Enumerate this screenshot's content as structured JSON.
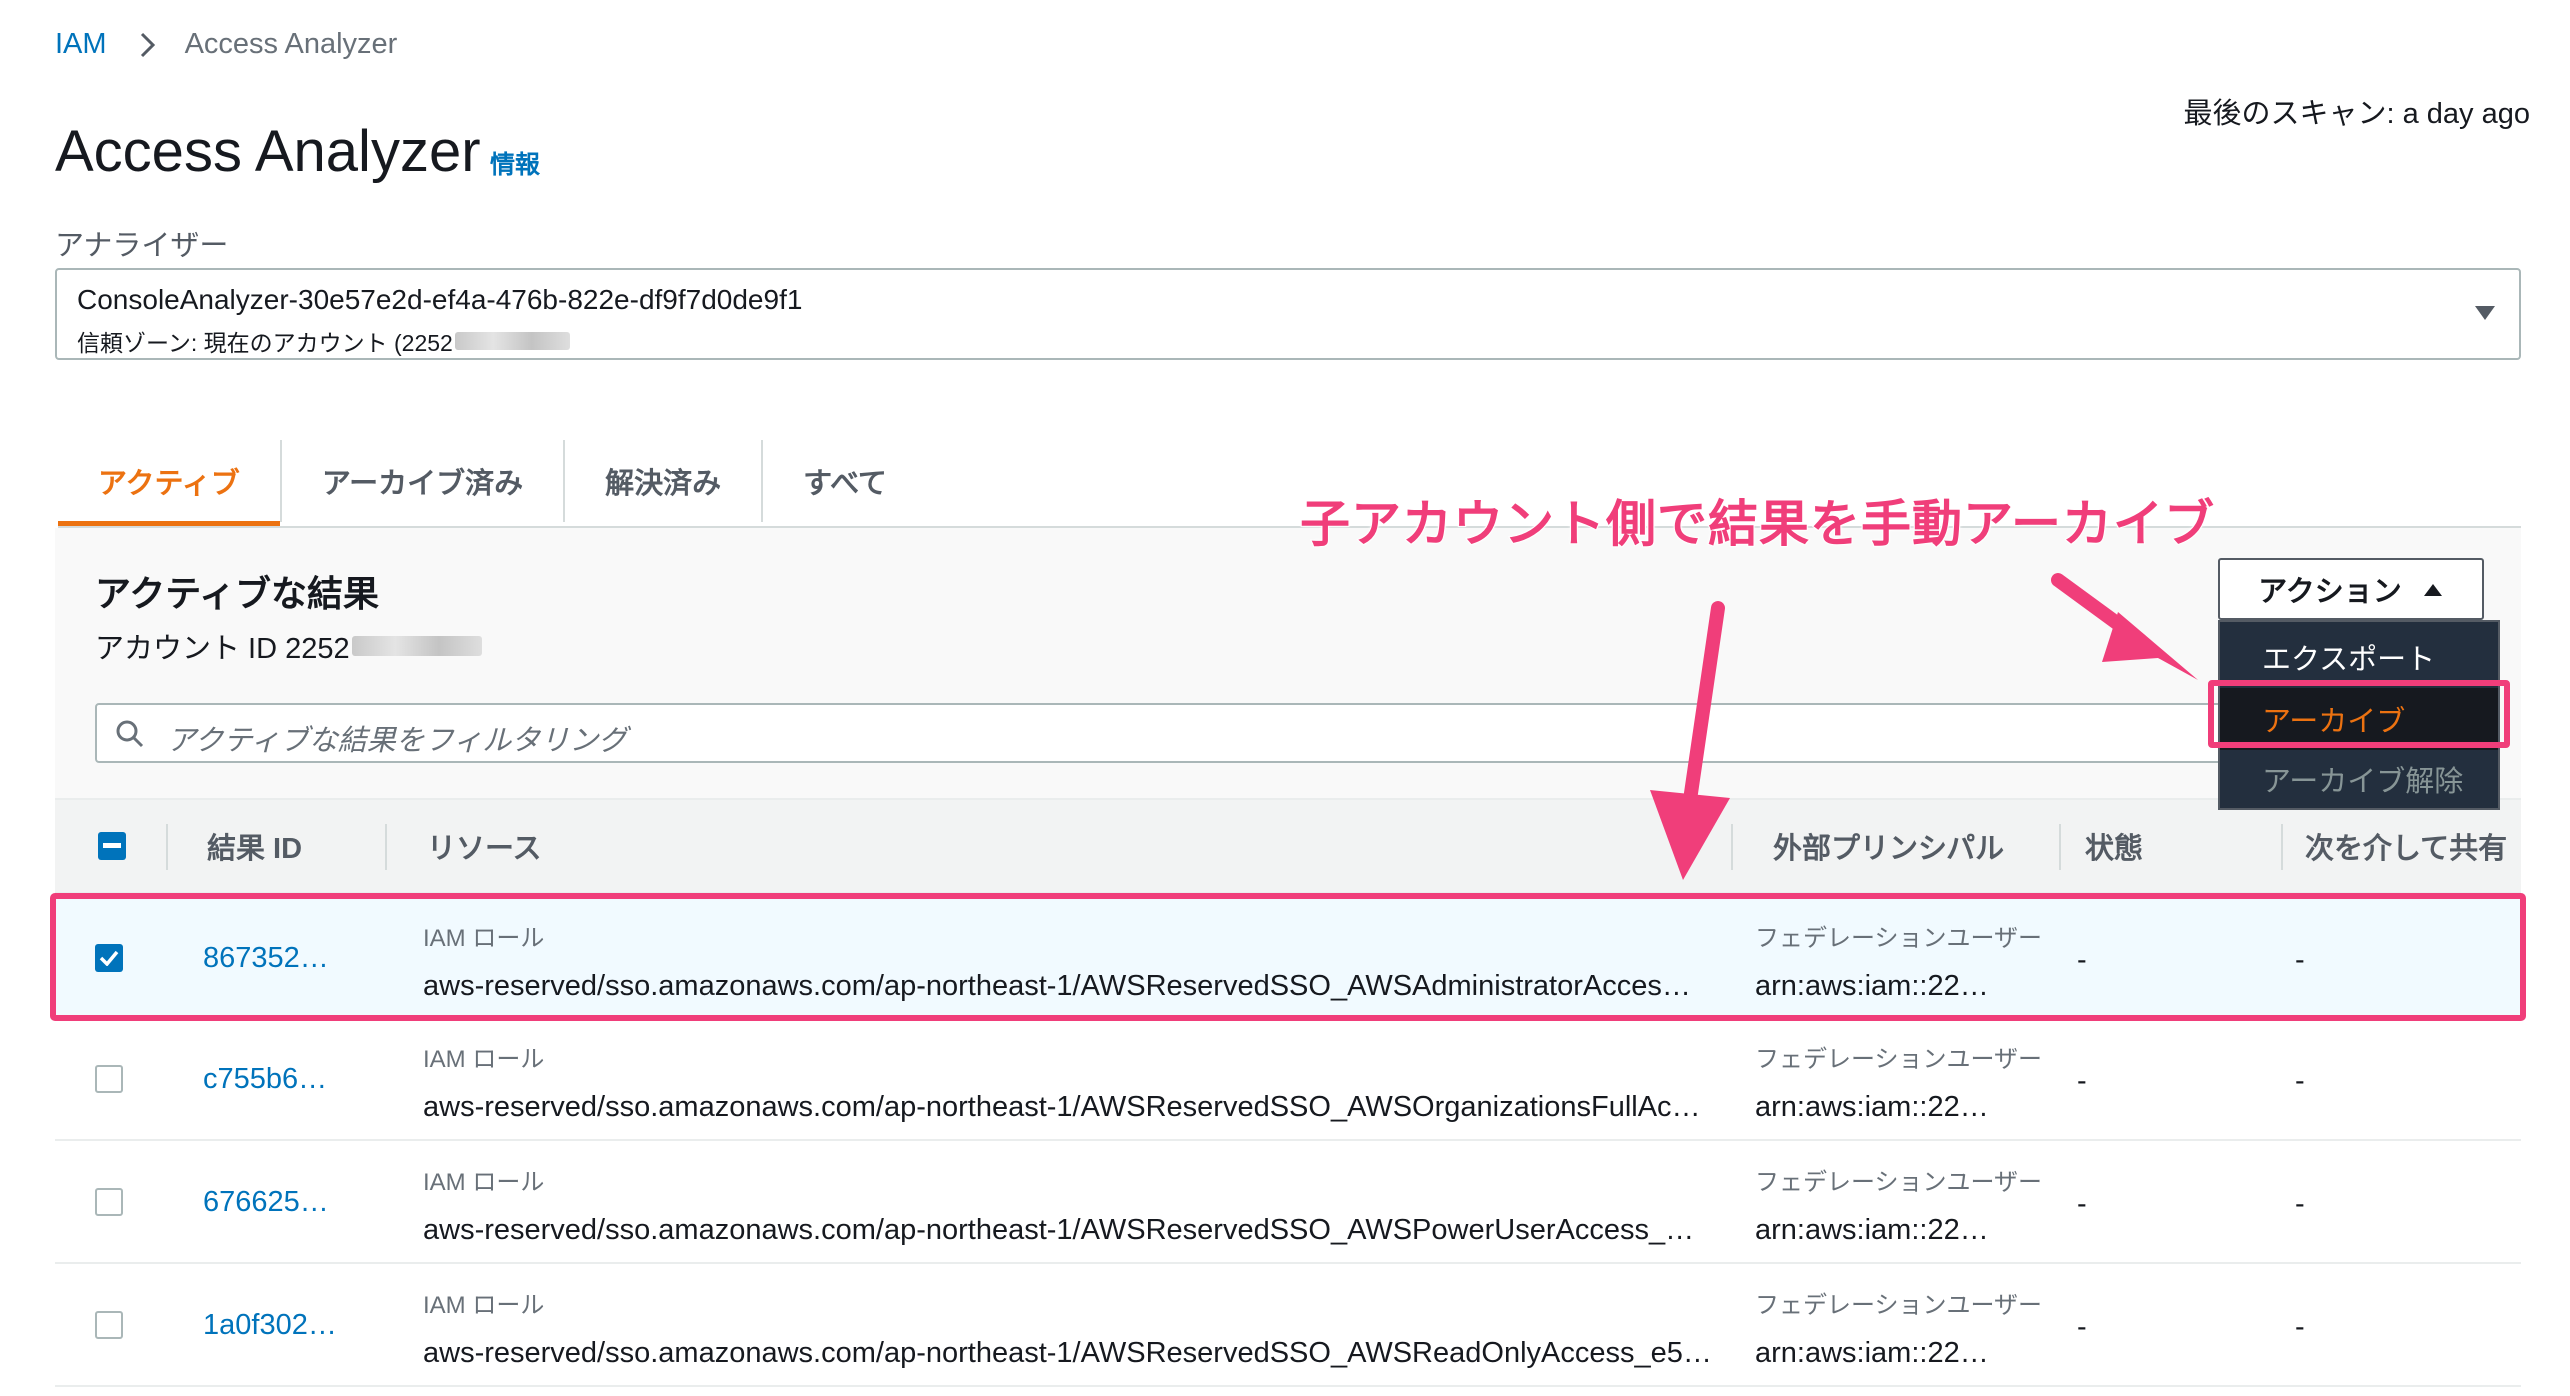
{
  "breadcrumb": {
    "root": "IAM",
    "current": "Access Analyzer"
  },
  "last_scan": "最後のスキャン: a day ago",
  "page": {
    "title": "Access Analyzer",
    "info": "情報"
  },
  "analyzer": {
    "label": "アナライザー",
    "name": "ConsoleAnalyzer-30e57e2d-ef4a-476b-822e-df9f7d0de9f1",
    "zone": "信頼ゾーン: 現在のアカウント (2252"
  },
  "tabs": [
    {
      "label": "アクティブ",
      "active": true
    },
    {
      "label": "アーカイブ済み",
      "active": false
    },
    {
      "label": "解決済み",
      "active": false
    },
    {
      "label": "すべて",
      "active": false
    }
  ],
  "results": {
    "title": "アクティブな結果",
    "account": "アカウント ID 2252",
    "filter_placeholder": "アクティブな結果をフィルタリング"
  },
  "actions": {
    "label": "アクション",
    "menu": [
      "エクスポート",
      "アーカイブ",
      "アーカイブ解除"
    ]
  },
  "table": {
    "headers": [
      "結果 ID",
      "リソース",
      "外部プリンシパル",
      "状態",
      "次を介して共有"
    ],
    "rows": [
      {
        "id": "867352…",
        "type": "IAM ロール",
        "resource": "aws-reserved/sso.amazonaws.com/ap-northeast-1/AWSReservedSSO_AWSAdministratorAcces…",
        "principal_type": "フェデレーションユーザー",
        "principal": "arn:aws:iam::22…",
        "state": "-",
        "shared": "-",
        "checked": true
      },
      {
        "id": "c755b6…",
        "type": "IAM ロール",
        "resource": "aws-reserved/sso.amazonaws.com/ap-northeast-1/AWSReservedSSO_AWSOrganizationsFullAc…",
        "principal_type": "フェデレーションユーザー",
        "principal": "arn:aws:iam::22…",
        "state": "-",
        "shared": "-",
        "checked": false
      },
      {
        "id": "676625…",
        "type": "IAM ロール",
        "resource": "aws-reserved/sso.amazonaws.com/ap-northeast-1/AWSReservedSSO_AWSPowerUserAccess_…",
        "principal_type": "フェデレーションユーザー",
        "principal": "arn:aws:iam::22…",
        "state": "-",
        "shared": "-",
        "checked": false
      },
      {
        "id": "1a0f302…",
        "type": "IAM ロール",
        "resource": "aws-reserved/sso.amazonaws.com/ap-northeast-1/AWSReservedSSO_AWSReadOnlyAccess_e5…",
        "principal_type": "フェデレーションユーザー",
        "principal": "arn:aws:iam::22…",
        "state": "-",
        "shared": "-",
        "checked": false
      }
    ]
  },
  "annotation": "子アカウント側で結果を手動アーカイブ",
  "colors": {
    "link": "#0073bb",
    "accent": "#ec7211",
    "annotation": "#f03e7a",
    "menu_bg": "#232f3e"
  }
}
